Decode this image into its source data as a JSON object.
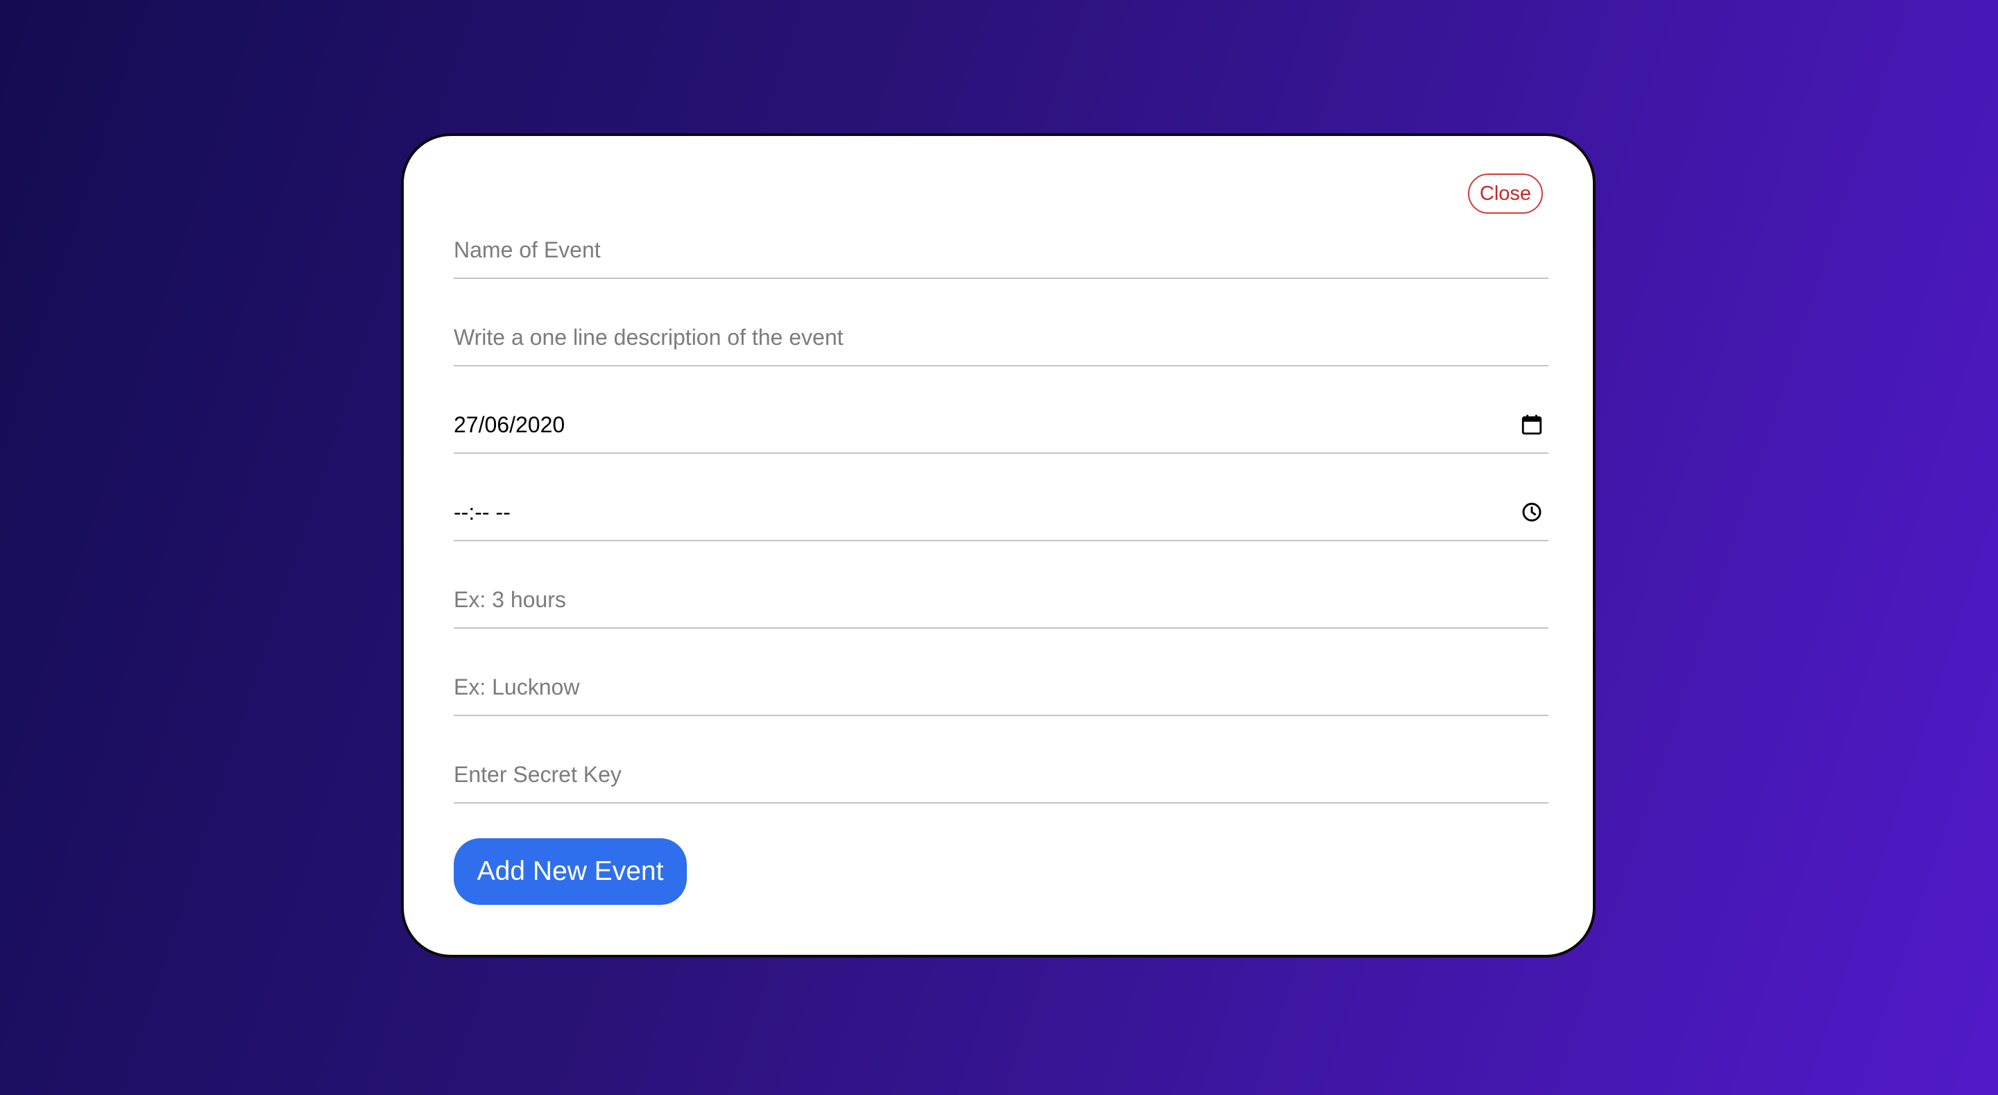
{
  "modal": {
    "close_label": "Close",
    "fields": {
      "name": {
        "placeholder": "Name of Event"
      },
      "description": {
        "placeholder": "Write a one line description of the event"
      },
      "date": {
        "value": "27/06/2020",
        "icon": "calendar-icon"
      },
      "time": {
        "value": "--:-- --",
        "icon": "clock-icon"
      },
      "duration": {
        "placeholder": "Ex: 3 hours"
      },
      "location": {
        "placeholder": "Ex: Lucknow"
      },
      "secret_key": {
        "placeholder": "Enter Secret Key"
      }
    },
    "submit_label": "Add New Event"
  },
  "colors": {
    "background_start": "#130c52",
    "background_end": "#5219c9",
    "submit_button": "#2f6fed",
    "close_button": "#c62828"
  }
}
